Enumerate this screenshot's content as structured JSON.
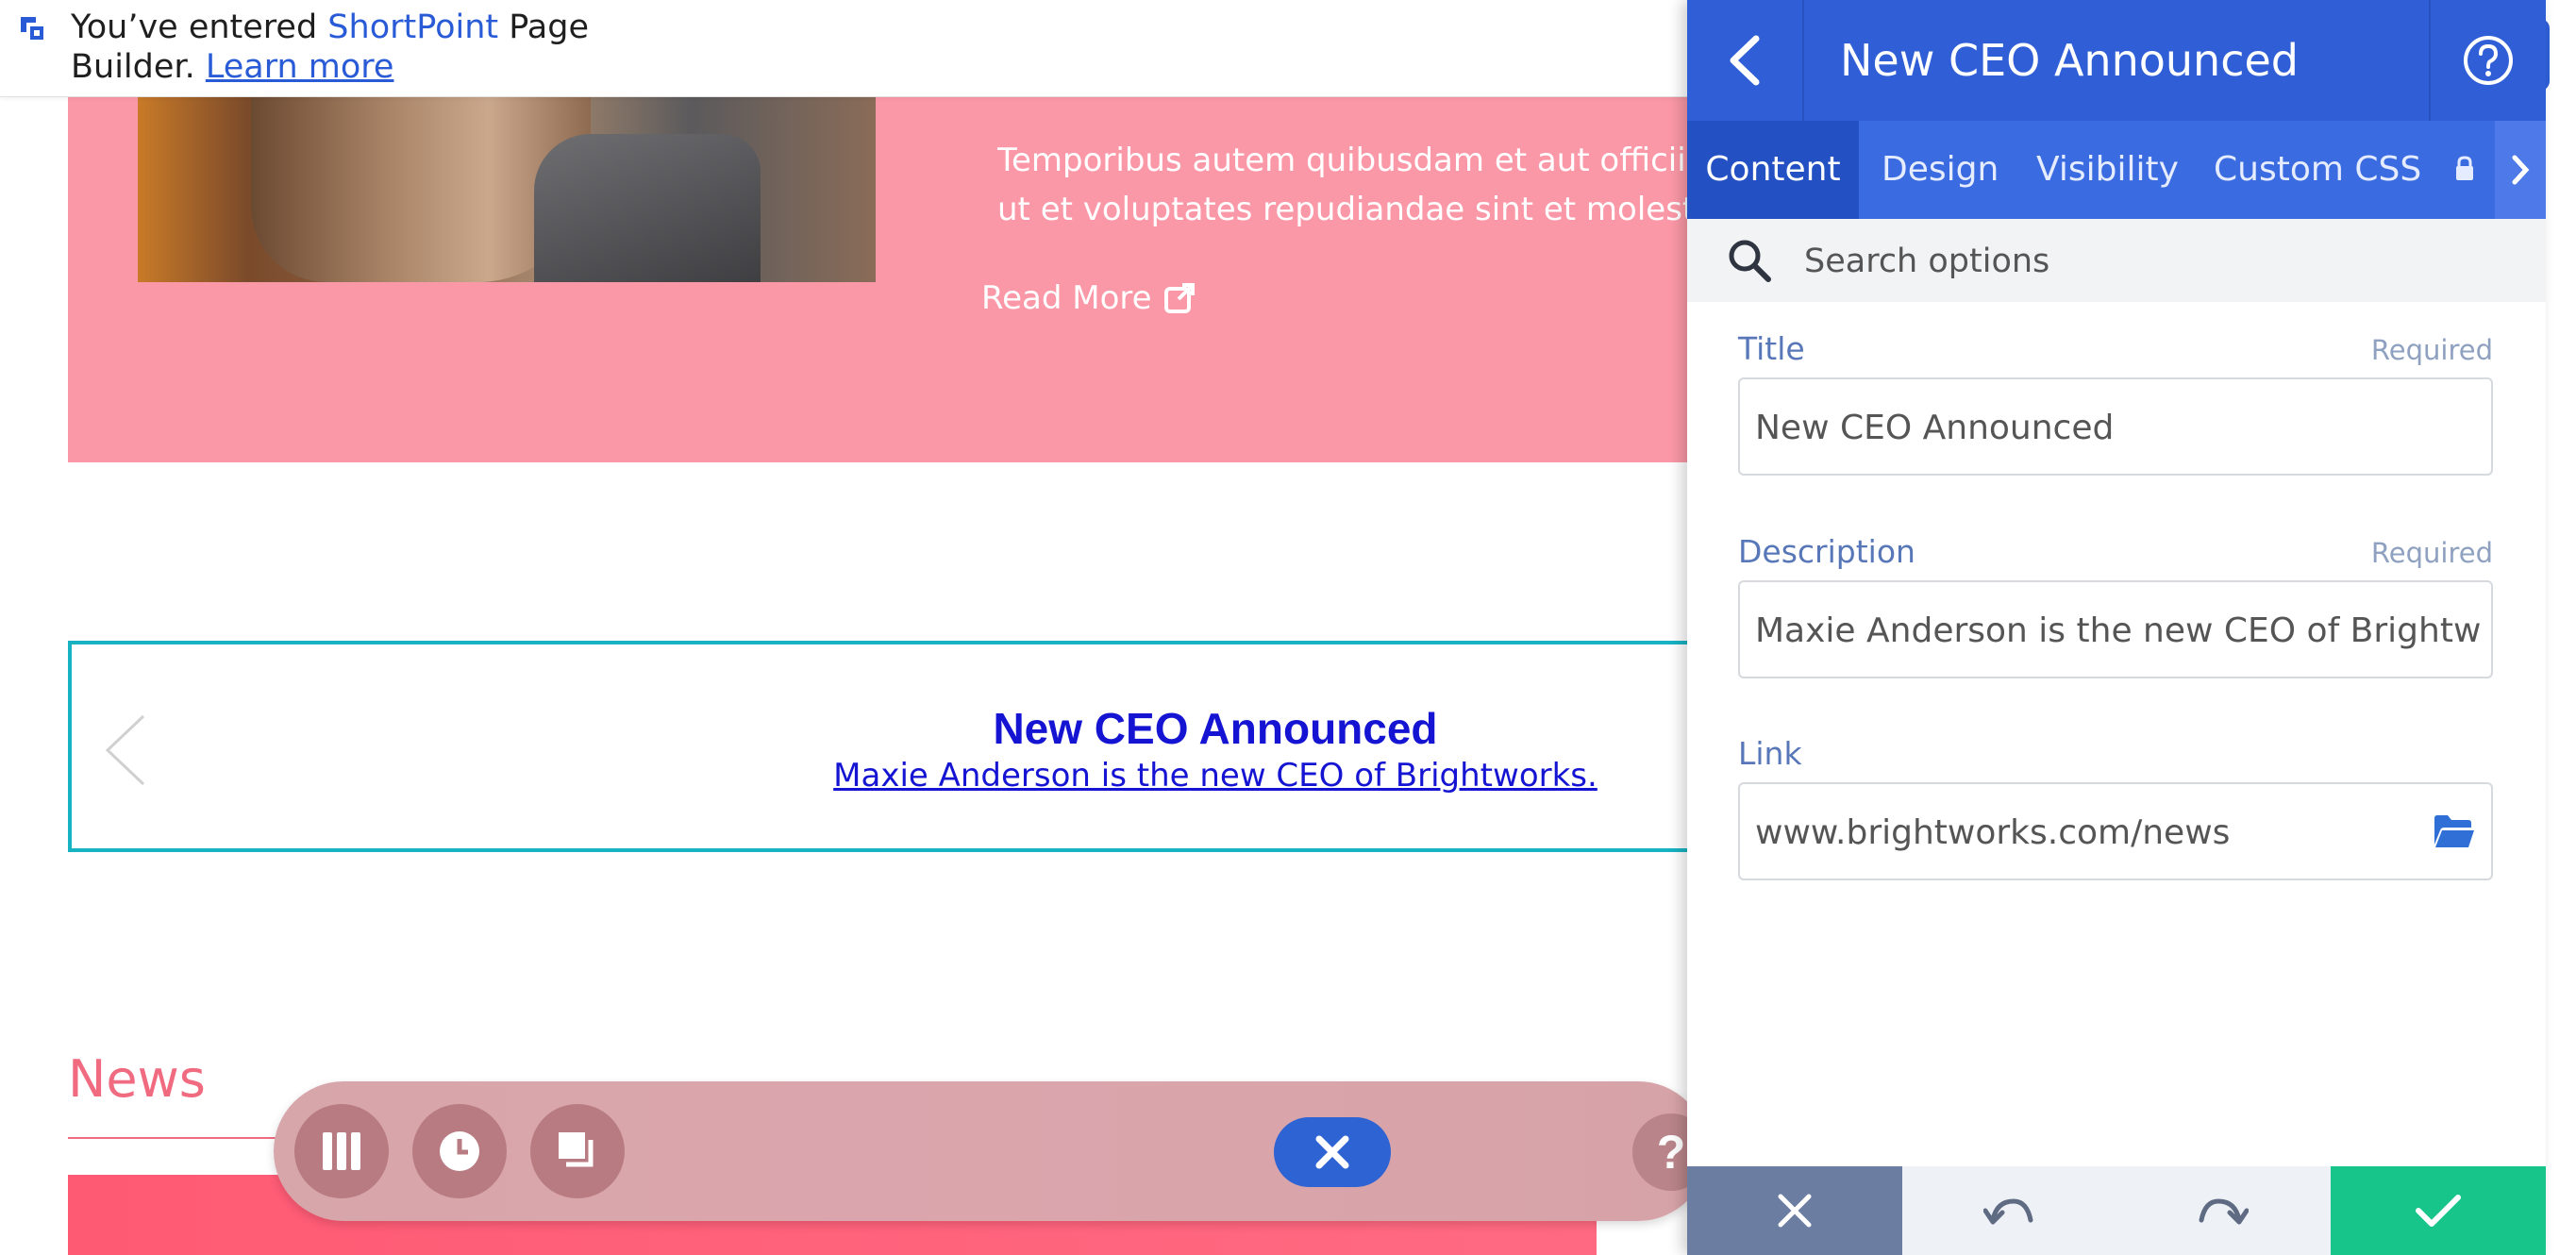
{
  "notice": {
    "prefix": "You’ve entered ",
    "brand": "ShortPoint",
    "suffix": " Page Builder. ",
    "link": "Learn more"
  },
  "hero": {
    "body_line1": "Temporibus autem quibusdam et aut officiis de",
    "body_line2": "ut et voluptates repudiandae sint et molestiae n",
    "read_more": "Read More"
  },
  "ticker": {
    "title": "New CEO Announced",
    "description": "Maxie Anderson is the new CEO of Brightworks."
  },
  "news": {
    "title": "News"
  },
  "toolbar": {
    "help": "?"
  },
  "panel": {
    "title": "New CEO Announced",
    "tabs": [
      "Content",
      "Design",
      "Visibility",
      "Custom CSS"
    ],
    "search_placeholder": "Search options",
    "fields": {
      "title": {
        "label": "Title",
        "required": "Required",
        "value": "New CEO Announced"
      },
      "description": {
        "label": "Description",
        "required": "Required",
        "value": "Maxie Anderson is the new CEO of Brightworks."
      },
      "link": {
        "label": "Link",
        "value": "www.brightworks.com/news"
      }
    }
  },
  "colors": {
    "accent": "#2f5ed6",
    "hero_pink": "#fb98a7",
    "ticker_border": "#17b3c3",
    "confirm": "#17c48a"
  }
}
